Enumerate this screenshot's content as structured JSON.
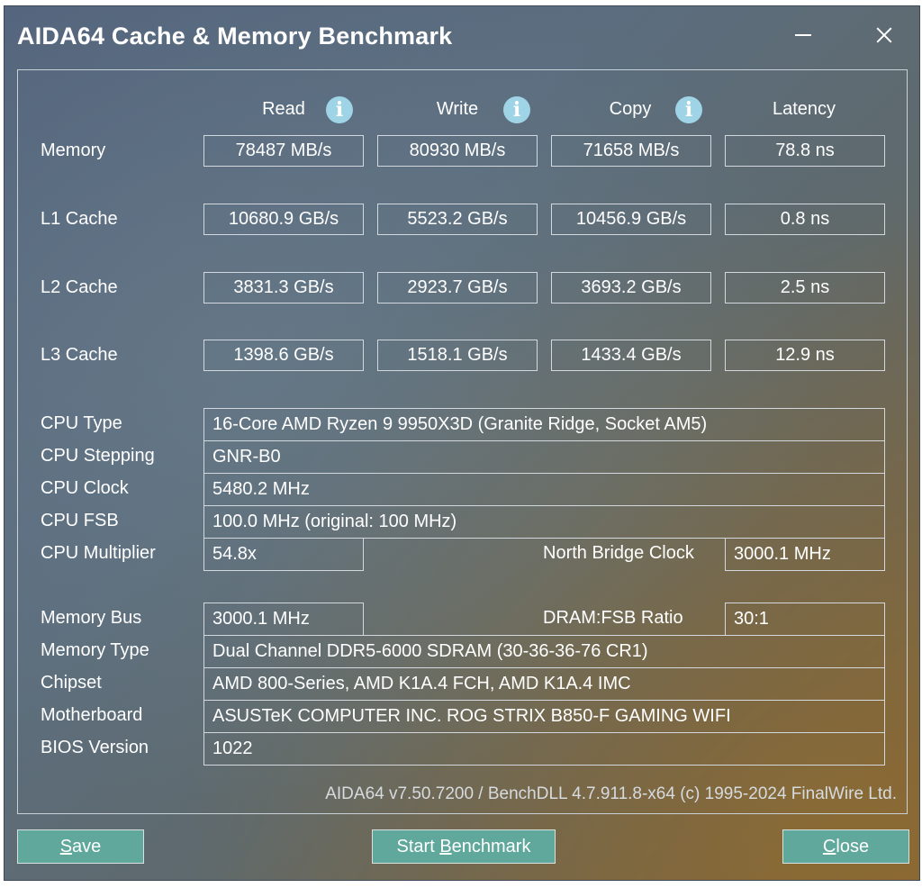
{
  "window": {
    "title": "AIDA64 Cache & Memory Benchmark"
  },
  "columns": {
    "read": "Read",
    "write": "Write",
    "copy": "Copy",
    "latency": "Latency"
  },
  "bench_rows": [
    {
      "label": "Memory",
      "read": "78487 MB/s",
      "write": "80930 MB/s",
      "copy": "71658 MB/s",
      "latency": "78.8 ns"
    },
    {
      "label": "L1 Cache",
      "read": "10680.9 GB/s",
      "write": "5523.2 GB/s",
      "copy": "10456.9 GB/s",
      "latency": "0.8 ns"
    },
    {
      "label": "L2 Cache",
      "read": "3831.3 GB/s",
      "write": "2923.7 GB/s",
      "copy": "3693.2 GB/s",
      "latency": "2.5 ns"
    },
    {
      "label": "L3 Cache",
      "read": "1398.6 GB/s",
      "write": "1518.1 GB/s",
      "copy": "1433.4 GB/s",
      "latency": "12.9 ns"
    }
  ],
  "cpu": {
    "type_label": "CPU Type",
    "type_value": "16-Core AMD Ryzen 9 9950X3D  (Granite Ridge, Socket AM5)",
    "stepping_label": "CPU Stepping",
    "stepping_value": "GNR-B0",
    "clock_label": "CPU Clock",
    "clock_value": "5480.2 MHz",
    "fsb_label": "CPU FSB",
    "fsb_value": "100.0 MHz  (original: 100 MHz)",
    "multiplier_label": "CPU Multiplier",
    "multiplier_value": "54.8x",
    "nb_clock_label": "North Bridge Clock",
    "nb_clock_value": "3000.1 MHz"
  },
  "memory": {
    "bus_label": "Memory Bus",
    "bus_value": "3000.1 MHz",
    "ratio_label": "DRAM:FSB Ratio",
    "ratio_value": "30:1",
    "type_label": "Memory Type",
    "type_value": "Dual Channel DDR5-6000 SDRAM  (30-36-36-76 CR1)",
    "chipset_label": "Chipset",
    "chipset_value": "AMD 800-Series, AMD K1A.4 FCH, AMD K1A.4 IMC",
    "motherboard_label": "Motherboard",
    "motherboard_value": "ASUSTeK COMPUTER INC. ROG STRIX B850-F GAMING WIFI",
    "bios_label": "BIOS Version",
    "bios_value": "1022"
  },
  "footer": {
    "version": "AIDA64 v7.50.7200 / BenchDLL 4.7.911.8-x64  (c) 1995-2024 FinalWire Ltd."
  },
  "buttons": {
    "save_mnemonic": "S",
    "save_rest": "ave",
    "start_prefix": "Start ",
    "start_mnemonic": "B",
    "start_rest": "enchmark",
    "close_mnemonic": "C",
    "close_rest": "lose"
  },
  "icons": {
    "info": "info-icon",
    "info_glyph": "i",
    "minimize": "minimize-icon",
    "close": "close-icon"
  },
  "colors": {
    "button_bg": "#5fa89b",
    "info_icon": "#9fd3e6"
  }
}
